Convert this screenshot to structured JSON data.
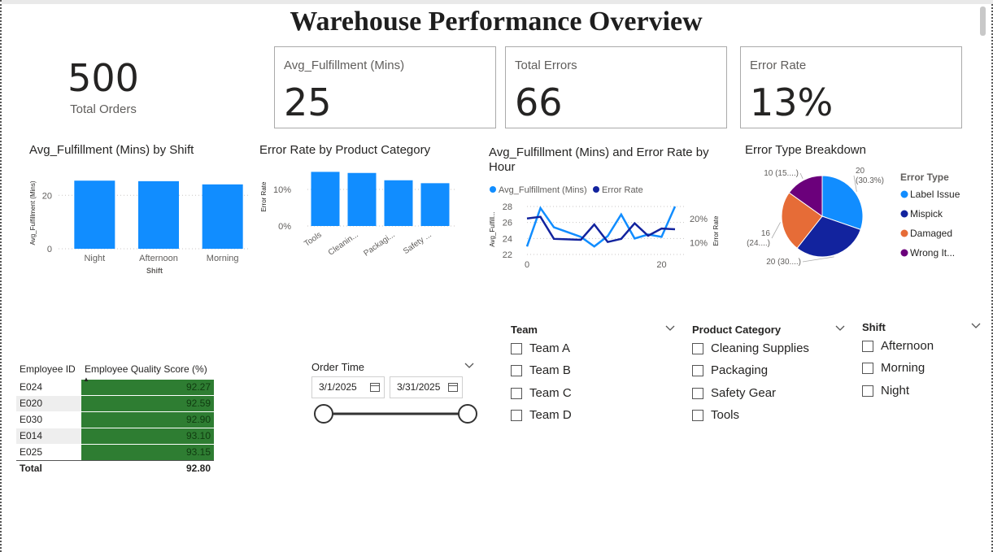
{
  "report": {
    "title": "Warehouse Performance Overview"
  },
  "kpis": {
    "total_orders": {
      "value": "500",
      "label": "Total Orders"
    },
    "avg_fulfillment": {
      "value": "25",
      "label": "Avg_Fulfillment (Mins)"
    },
    "total_errors": {
      "value": "66",
      "label": "Total Errors"
    },
    "error_rate": {
      "value": "13%",
      "label": "Error Rate"
    }
  },
  "visual_titles": {
    "by_shift": "Avg_Fulfillment (Mins) by Shift",
    "by_category": "Error Rate by Product Category",
    "by_hour_line1": "Avg_Fulfillment (Mins) and Error Rate by",
    "by_hour_line2": "Hour",
    "breakdown": "Error Type Breakdown"
  },
  "colors": {
    "primary_blue": "#118dff",
    "dark_blue": "#12239e",
    "orange": "#e66c37",
    "purple": "#6b007b",
    "table_green": "#2e7d32"
  },
  "chart_data": [
    {
      "type": "bar",
      "title": "Avg_Fulfillment (Mins) by Shift",
      "categories": [
        "Night",
        "Afternoon",
        "Morning"
      ],
      "values": [
        25.5,
        25.3,
        24.1
      ],
      "xlabel": "Shift",
      "ylabel": "Avg_Fulfillment (Mins)",
      "ylim": [
        0,
        28
      ],
      "yticks": [
        "0",
        "20"
      ],
      "grid": true
    },
    {
      "type": "bar",
      "title": "Error Rate by Product Category",
      "categories": [
        "Tools",
        "Cleanin...",
        "Packagi...",
        "Safety ..."
      ],
      "values": [
        14.8,
        14.5,
        12.5,
        11.7
      ],
      "ylabel": "Error Rate",
      "ylim": [
        0,
        16
      ],
      "yticks": [
        "0%",
        "10%"
      ],
      "grid": true
    },
    {
      "type": "line",
      "title": "Avg_Fulfillment (Mins) and Error Rate by Hour",
      "x": [
        0,
        2,
        4,
        6,
        8,
        10,
        12,
        14,
        16,
        18,
        20,
        22
      ],
      "series": [
        {
          "name": "Avg_Fulfillment (Mins)",
          "axis": "left",
          "values": [
            23,
            27.8,
            25.4,
            24.8,
            24.2,
            23,
            24.3,
            27,
            24,
            24.5,
            24.2,
            28
          ]
        },
        {
          "name": "Error Rate",
          "axis": "right",
          "values": [
            20,
            20.7,
            11.5,
            11.3,
            11.1,
            17.5,
            10.2,
            11.5,
            18,
            12.8,
            15.8,
            15.5
          ]
        }
      ],
      "xlim": [
        0,
        22
      ],
      "y_left": {
        "label": "Avg_Fulfill...",
        "ylim": [
          22,
          28
        ],
        "ticks": [
          "22",
          "24",
          "26",
          "28"
        ]
      },
      "y_right": {
        "label": "Error Rate",
        "ylim": [
          5,
          25
        ],
        "ticks": [
          "10%",
          "20%"
        ]
      },
      "xticks": [
        "0",
        "20"
      ],
      "legend": "top-left"
    },
    {
      "type": "pie",
      "title": "Error Type Breakdown",
      "legend_title": "Error Type",
      "legend_position": "right",
      "slices": [
        {
          "name": "Label Issue",
          "value": 20,
          "label": "20\n(30.3%)"
        },
        {
          "name": "Mispick",
          "value": 20,
          "label": "20 (30....)"
        },
        {
          "name": "Damaged",
          "value": 16,
          "label": "16\n(24....)"
        },
        {
          "name": "Wrong It...",
          "value": 10,
          "label": "10 (15....)"
        }
      ]
    }
  ],
  "employee_table": {
    "headers": [
      "Employee ID",
      "Employee Quality Score (%)"
    ],
    "rows": [
      {
        "id": "E024",
        "score": "92.27"
      },
      {
        "id": "E020",
        "score": "92.59"
      },
      {
        "id": "E030",
        "score": "92.90"
      },
      {
        "id": "E014",
        "score": "93.10"
      },
      {
        "id": "E025",
        "score": "93.15"
      }
    ],
    "total_label": "Total",
    "total_value": "92.80"
  },
  "order_time": {
    "label": "Order Time",
    "start": "3/1/2025",
    "end": "3/31/2025"
  },
  "slicers": {
    "team": {
      "label": "Team",
      "options": [
        "Team A",
        "Team B",
        "Team C",
        "Team D"
      ]
    },
    "category": {
      "label": "Product Category",
      "options": [
        "Cleaning Supplies",
        "Packaging",
        "Safety Gear",
        "Tools"
      ]
    },
    "shift": {
      "label": "Shift",
      "options": [
        "Afternoon",
        "Morning",
        "Night"
      ]
    }
  }
}
